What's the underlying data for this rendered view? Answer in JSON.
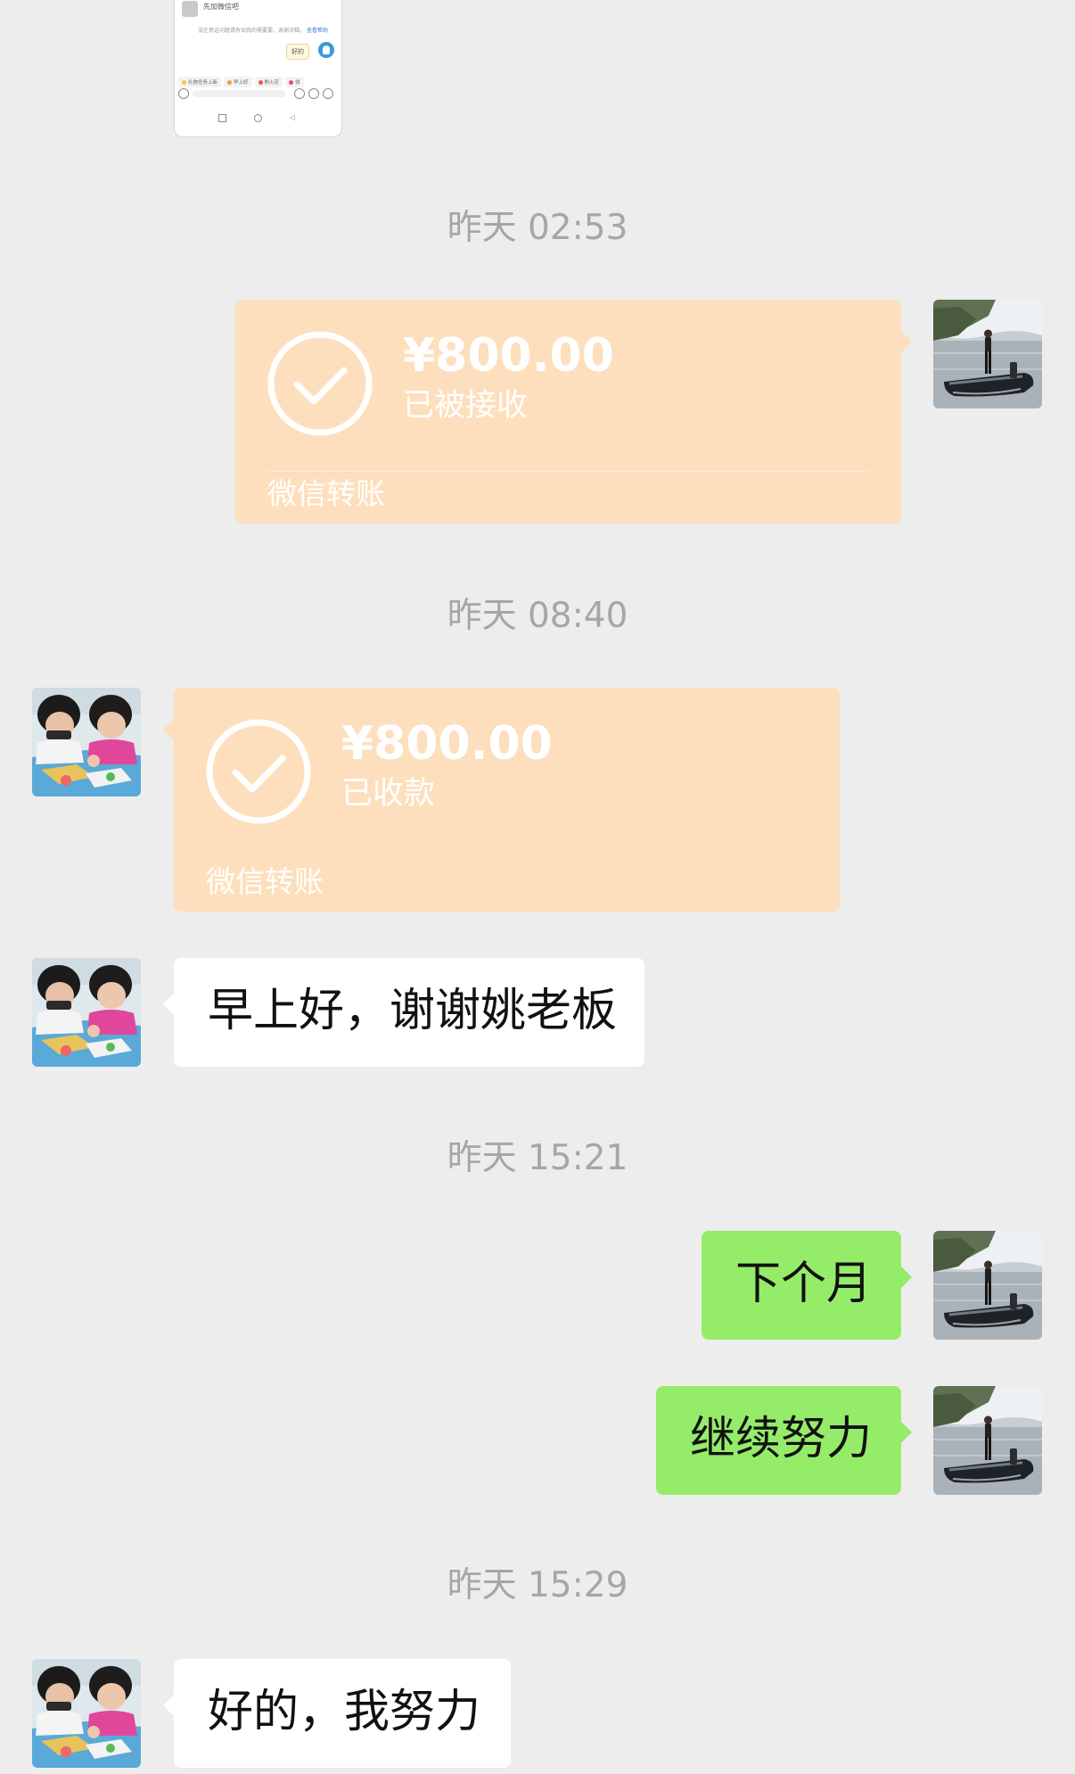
{
  "thumbnail": {
    "title": "先加微信吧",
    "line": "没在意这问题请有如我的需要要。谢谢详辑。",
    "link": "查看帮助",
    "reply": "好的",
    "chips": [
      "礼物任务上新",
      "早上好",
      "熊火花",
      "领"
    ]
  },
  "timestamps": {
    "t1": "昨天 02:53",
    "t2": "昨天 08:40",
    "t3": "昨天 15:21",
    "t4": "昨天 15:29"
  },
  "transfer_sent": {
    "amount": "¥800.00",
    "status": "已被接收",
    "label": "微信转账"
  },
  "transfer_received": {
    "amount": "¥800.00",
    "status": "已收款",
    "label": "微信转账"
  },
  "messages": {
    "m1": "早上好，谢谢姚老板",
    "m2": "下个月",
    "m3": "继续努力",
    "m4": "好的，我努力"
  },
  "colors": {
    "background": "#ededed",
    "transfer_card": "#fddfbd",
    "sent_bubble": "#95ec69",
    "received_bubble": "#ffffff",
    "timestamp": "#a6a6a6"
  }
}
